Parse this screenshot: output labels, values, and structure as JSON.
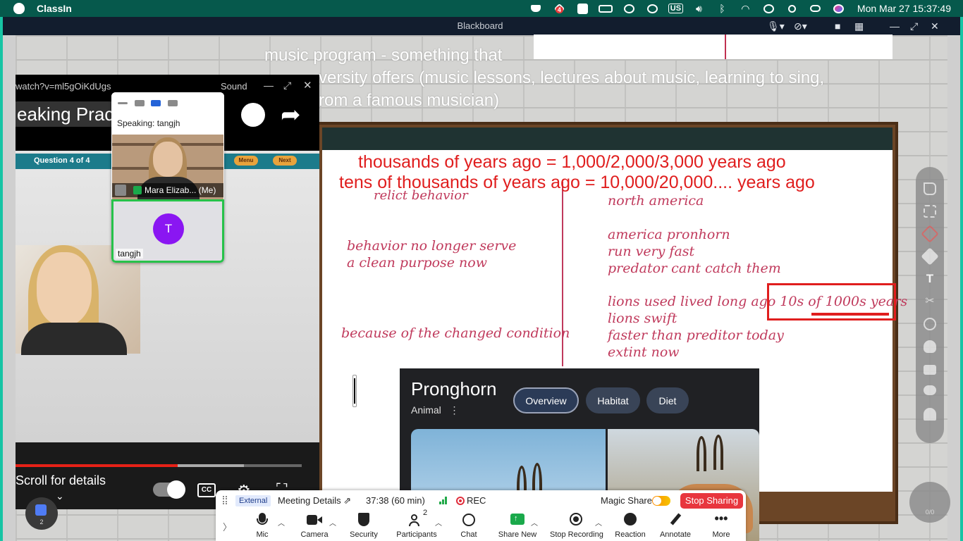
{
  "menubar": {
    "app_name": "ClassIn",
    "badge_count": "4",
    "lang": "US",
    "clock": "Mon Mar 27  15:37:49"
  },
  "window": {
    "title": "Blackboard"
  },
  "background_text": {
    "line1": "music program - something that",
    "line2": "versity offers (music lessons, lectures about music, learning to sing,",
    "line3": "rom a famous musician)"
  },
  "board": {
    "red_line1": "thousands of years ago = 1,000/2,000/3,000 years ago",
    "red_line2": "tens of thousands of years ago = 10,000/20,000.... years ago",
    "left_notes": [
      "relict behavior",
      "behavior no longer serve",
      "a clean purpose now",
      "because of the changed condition"
    ],
    "right_notes": [
      "north america",
      "america pronhorn",
      "run very fast",
      "predator cant catch them",
      "lions used lived long ago 10s of 1000s years",
      "lions swift",
      "faster than preditor today",
      "extint now"
    ]
  },
  "pronghorn_card": {
    "title": "Pronghorn",
    "subtitle": "Animal",
    "more_icon": "⋮",
    "tabs": [
      "Overview",
      "Habitat",
      "Diet"
    ],
    "active_tab": "Overview"
  },
  "youtube": {
    "url_fragment": "watch?v=ml5gOiKdUgs",
    "sound_label": "Sound",
    "video_title": "eaking Prac",
    "question_label": "Question 4 of 4",
    "menu_btn": "Menu",
    "next_btn": "Next",
    "scroll_text": "Scroll for details",
    "cc": "CC",
    "progress": 0.566,
    "buffered": 0.797
  },
  "video_panel": {
    "speaking_label": "Speaking: tangjh",
    "self_name": "Mara Elizab... (Me)",
    "participant_name": "tangjh",
    "participant_initial": "T"
  },
  "participants_bubble": {
    "count": "2"
  },
  "zoom_bar": {
    "external": "External",
    "meeting_details": "Meeting Details",
    "timer": "37:38  (60 min)",
    "rec": "REC",
    "magic_share": "Magic Share",
    "stop_sharing": "Stop Sharing",
    "participants_count": "2",
    "buttons": [
      {
        "label": "Mic",
        "icon": "mic-icon"
      },
      {
        "label": "Camera",
        "icon": "camera-icon"
      },
      {
        "label": "Security",
        "icon": "shield-icon"
      },
      {
        "label": "Participants",
        "icon": "participants-icon"
      },
      {
        "label": "Chat",
        "icon": "chat-icon"
      },
      {
        "label": "Share New",
        "icon": "share-screen-icon"
      },
      {
        "label": "Stop Recording",
        "icon": "record-icon"
      },
      {
        "label": "Reaction",
        "icon": "smile-icon"
      },
      {
        "label": "Annotate",
        "icon": "pen-icon"
      },
      {
        "label": "More",
        "icon": "more-icon"
      }
    ]
  },
  "toolbox": {
    "hand_count": "0/0"
  },
  "colors": {
    "accent_teal": "#17c4a4",
    "annotation_red": "#e01e1e",
    "handwriting": "#c03a5c",
    "stop_sharing": "#e8363e",
    "speaking_border": "#27c24a"
  }
}
